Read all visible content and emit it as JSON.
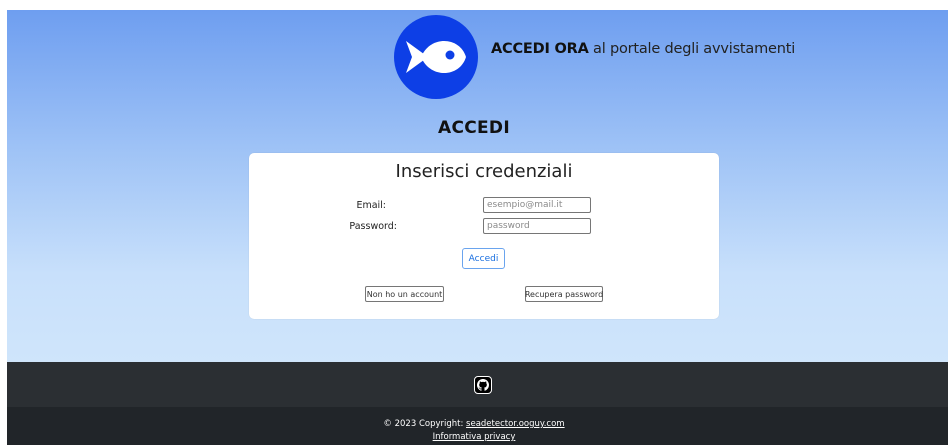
{
  "header": {
    "tagline_bold": "ACCEDI ORA",
    "tagline_rest": " al portale degli avvistamenti",
    "logo_icon": "fish-icon",
    "logo_color": "#0d3fe6"
  },
  "login": {
    "heading": "ACCEDI",
    "card_title": "Inserisci credenziali",
    "email_label": "Email:",
    "email_placeholder": "esempio@mail.it",
    "password_label": "Password:",
    "password_placeholder": "password",
    "submit_label": "Accedi",
    "no_account_label": "Non ho un account",
    "recover_label": "Recupera password"
  },
  "footer": {
    "github_icon": "github-icon",
    "copyright_prefix": "© 2023 Copyright: ",
    "copyright_link": "seadetector.ooguy.com",
    "privacy_link": "Informativa privacy"
  }
}
